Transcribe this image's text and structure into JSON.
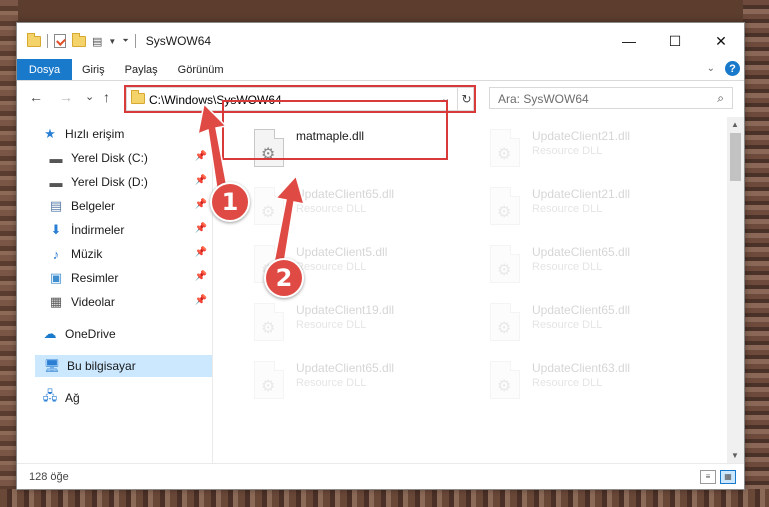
{
  "window": {
    "title": "SysWOW64",
    "controls": {
      "minimize": "—",
      "maximize": "☐",
      "close": "✕"
    }
  },
  "ribbon": {
    "tabs": [
      "Dosya",
      "Giriş",
      "Paylaş",
      "Görünüm"
    ],
    "help": "?"
  },
  "navbar": {
    "back": "←",
    "forward": "→",
    "recent": "⌄",
    "up": "↑",
    "address": "C:\\Windows\\SysWOW64",
    "search_placeholder": "Ara: SysWOW64"
  },
  "sidebar": {
    "items": [
      {
        "label": "Hızlı erişim",
        "icon": "star-icon"
      },
      {
        "label": "Yerel Disk (C:)",
        "icon": "drive-icon",
        "pinned": true
      },
      {
        "label": "Yerel Disk (D:)",
        "icon": "drive-icon",
        "pinned": true
      },
      {
        "label": "Belgeler",
        "icon": "document-icon",
        "pinned": true
      },
      {
        "label": "İndirmeler",
        "icon": "download-icon",
        "pinned": true
      },
      {
        "label": "Müzik",
        "icon": "music-icon",
        "pinned": true
      },
      {
        "label": "Resimler",
        "icon": "pictures-icon",
        "pinned": true
      },
      {
        "label": "Videolar",
        "icon": "videos-icon",
        "pinned": true
      },
      {
        "label": "OneDrive",
        "icon": "cloud-icon"
      },
      {
        "label": "Bu bilgisayar",
        "icon": "computer-icon",
        "selected": true
      },
      {
        "label": "Ağ",
        "icon": "network-icon"
      }
    ]
  },
  "files": [
    {
      "name": "matmaple.dll",
      "type": "",
      "faded": false
    },
    {
      "name": "UpdateClient21.dll",
      "type": "Resource DLL",
      "faded": true
    },
    {
      "name": "UpdateClient65.dll",
      "type": "Resource DLL",
      "faded": true
    },
    {
      "name": "UpdateClient21.dll",
      "type": "Resource DLL",
      "faded": true
    },
    {
      "name": "UpdateClient5.dll",
      "type": "Resource DLL",
      "faded": true
    },
    {
      "name": "UpdateClient65.dll",
      "type": "Resource DLL",
      "faded": true
    },
    {
      "name": "UpdateClient19.dll",
      "type": "Resource DLL",
      "faded": true
    },
    {
      "name": "UpdateClient65.dll",
      "type": "Resource DLL",
      "faded": true
    },
    {
      "name": "UpdateClient65.dll",
      "type": "Resource DLL",
      "faded": true
    },
    {
      "name": "UpdateClient63.dll",
      "type": "Resource DLL",
      "faded": true
    }
  ],
  "status": {
    "count": "128 öğe"
  },
  "annotations": {
    "step1": "1",
    "step2": "2"
  },
  "colors": {
    "accent": "#1979ca",
    "highlight": "#d83a3a",
    "selected": "#cce8ff"
  }
}
